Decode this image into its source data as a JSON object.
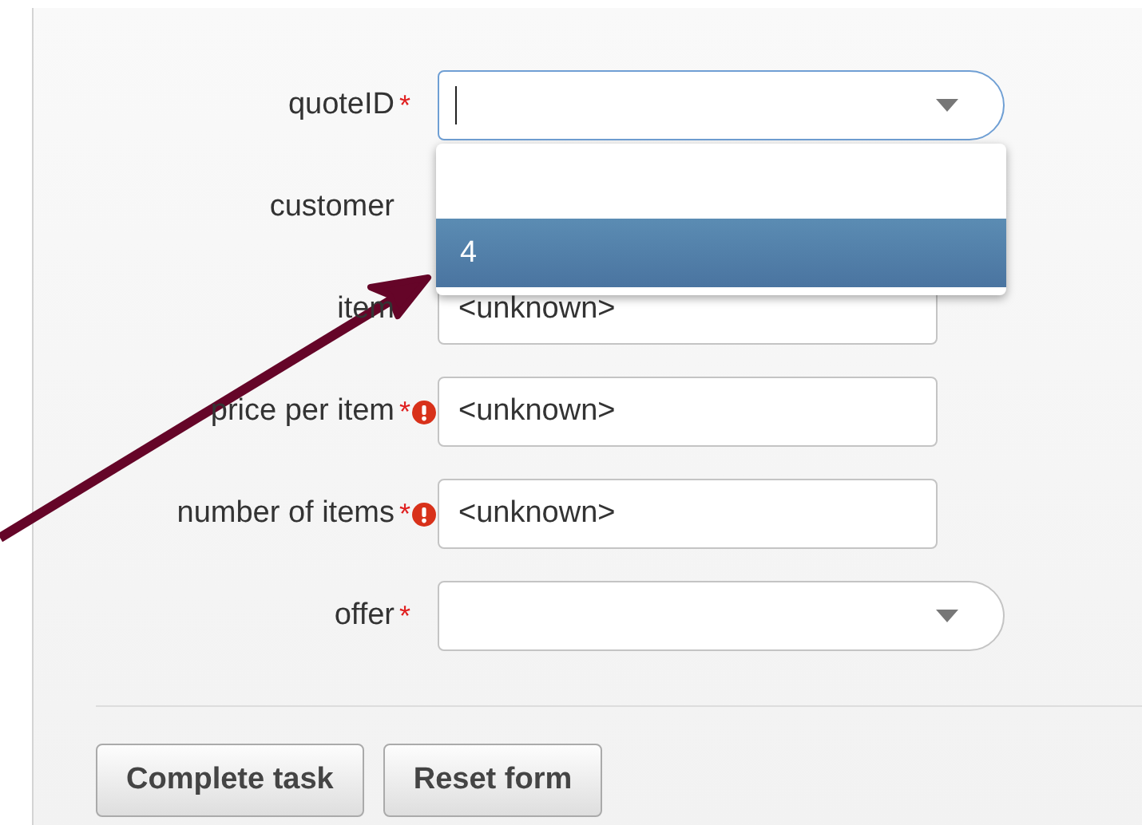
{
  "fields": [
    {
      "label": "quoteID",
      "marker": "*",
      "error": false,
      "kind": "combo",
      "focused": true,
      "menu": {
        "options": [
          {
            "label": "4",
            "selected": true
          }
        ]
      }
    },
    {
      "label": "customer",
      "kind": "covered"
    },
    {
      "label": "item",
      "kind": "text",
      "value": "<unknown>"
    },
    {
      "label": "price per item",
      "marker": "*",
      "error": true,
      "kind": "text",
      "value": "<unknown>"
    },
    {
      "label": "number of items",
      "marker": "*",
      "error": true,
      "kind": "text",
      "value": "<unknown>"
    },
    {
      "label": "offer",
      "marker": "*",
      "error": false,
      "kind": "combo",
      "focused": false
    }
  ],
  "buttons": [
    "Complete task",
    "Reset form"
  ]
}
